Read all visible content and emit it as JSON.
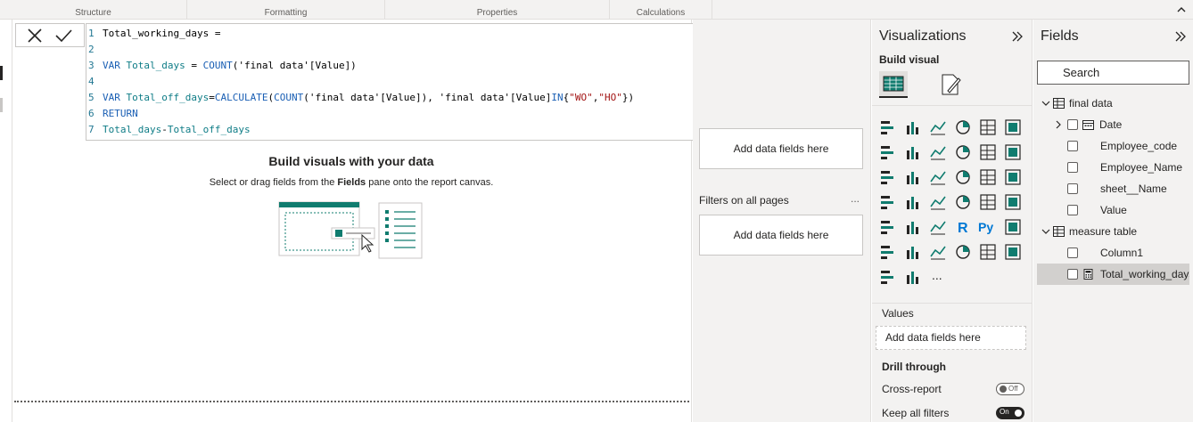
{
  "ribbon": {
    "groups": [
      "Structure",
      "Formatting",
      "Properties",
      "Calculations"
    ]
  },
  "canvas": {
    "empty_title": "Build visuals with your data",
    "empty_sub_before": "Select or drag fields from the ",
    "empty_sub_bold": "Fields",
    "empty_sub_after": " pane onto the report canvas."
  },
  "formula": {
    "lines": [
      {
        "n": "1",
        "parts": [
          {
            "c": "plain",
            "t": "Total_working_days ="
          }
        ]
      },
      {
        "n": "2",
        "parts": []
      },
      {
        "n": "3",
        "parts": [
          {
            "c": "kw",
            "t": "VAR "
          },
          {
            "c": "fn2",
            "t": "Total_days"
          },
          {
            "c": "plain",
            "t": " = "
          },
          {
            "c": "kw",
            "t": "COUNT"
          },
          {
            "c": "plain",
            "t": "('final data'[Value])"
          }
        ]
      },
      {
        "n": "4",
        "parts": []
      },
      {
        "n": "5",
        "parts": [
          {
            "c": "kw",
            "t": "VAR "
          },
          {
            "c": "fn2",
            "t": "Total_off_days"
          },
          {
            "c": "plain",
            "t": "="
          },
          {
            "c": "kw",
            "t": "CALCULATE"
          },
          {
            "c": "plain",
            "t": "("
          },
          {
            "c": "kw",
            "t": "COUNT"
          },
          {
            "c": "plain",
            "t": "('final data'[Value]), 'final data'[Value]"
          },
          {
            "c": "kw",
            "t": "IN"
          },
          {
            "c": "plain",
            "t": "{"
          },
          {
            "c": "str",
            "t": "\"WO\""
          },
          {
            "c": "plain",
            "t": ","
          },
          {
            "c": "str",
            "t": "\"HO\""
          },
          {
            "c": "plain",
            "t": "})"
          }
        ]
      },
      {
        "n": "6",
        "parts": [
          {
            "c": "kw",
            "t": "RETURN"
          }
        ]
      },
      {
        "n": "7",
        "parts": [
          {
            "c": "fn2",
            "t": "Total_days"
          },
          {
            "c": "plain",
            "t": "-"
          },
          {
            "c": "fn2",
            "t": "Total_off_days"
          }
        ]
      }
    ]
  },
  "filters": {
    "drop1": "Add data fields here",
    "section_all_pages": "Filters on all pages",
    "more": "...",
    "drop2": "Add data fields here"
  },
  "visualizations": {
    "title": "Visualizations",
    "build_visual": "Build visual",
    "values_label": "Values",
    "values_well": "Add data fields here",
    "drill_through": "Drill through",
    "cross_report": "Cross-report",
    "cross_report_state": "Off",
    "keep_all_filters": "Keep all filters",
    "keep_all_filters_state": "On",
    "more_visuals": "...",
    "colors": {
      "accent": "#107c6f",
      "dark": "#252423",
      "blue": "#0078d4",
      "yellow": "#f2c811"
    }
  },
  "fields": {
    "title": "Fields",
    "search_placeholder": "Search",
    "tables": [
      {
        "name": "final data",
        "columns": [
          {
            "name": "Date",
            "expandable": true,
            "type": "calendar"
          },
          {
            "name": "Employee_code"
          },
          {
            "name": "Employee_Name"
          },
          {
            "name": "sheet__Name"
          },
          {
            "name": "Value"
          }
        ]
      },
      {
        "name": "measure table",
        "columns": [
          {
            "name": "Column1"
          },
          {
            "name": "Total_working_days",
            "type": "measure",
            "selected": true
          }
        ]
      }
    ]
  }
}
